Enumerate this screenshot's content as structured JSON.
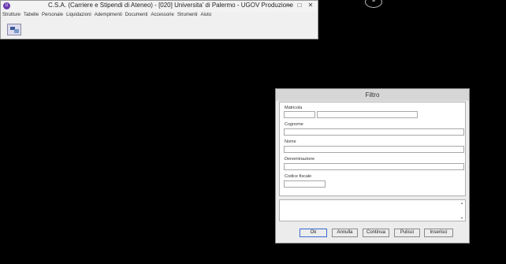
{
  "main_window": {
    "title": "C.S.A. (Carriere e Stipendi di Ateneo) - [020] Universita' di Palermo - UGOV Produzione",
    "controls": {
      "minimize": "–",
      "maximize": "□",
      "close": "✕"
    },
    "menu": [
      "Strutture",
      "Tabelle",
      "Personale",
      "Liquidazioni",
      "Adempimenti",
      "Documenti",
      "Accessorie",
      "Strumenti",
      "Aiuto"
    ]
  },
  "floating_widget": {
    "glyph": "≡"
  },
  "dialog": {
    "title": "Filtro",
    "fields": {
      "matricola_label": "Matricola",
      "cognome_label": "Cognome",
      "nome_label": "Nome",
      "denominazione_label": "Denominazione",
      "codice_fiscale_label": "Codice fiscale"
    },
    "buttons": {
      "ok": "Ok",
      "annulla": "Annulla",
      "continua": "Continua",
      "pulisci": "Pulisci",
      "inserisci": "Inserisci"
    }
  }
}
